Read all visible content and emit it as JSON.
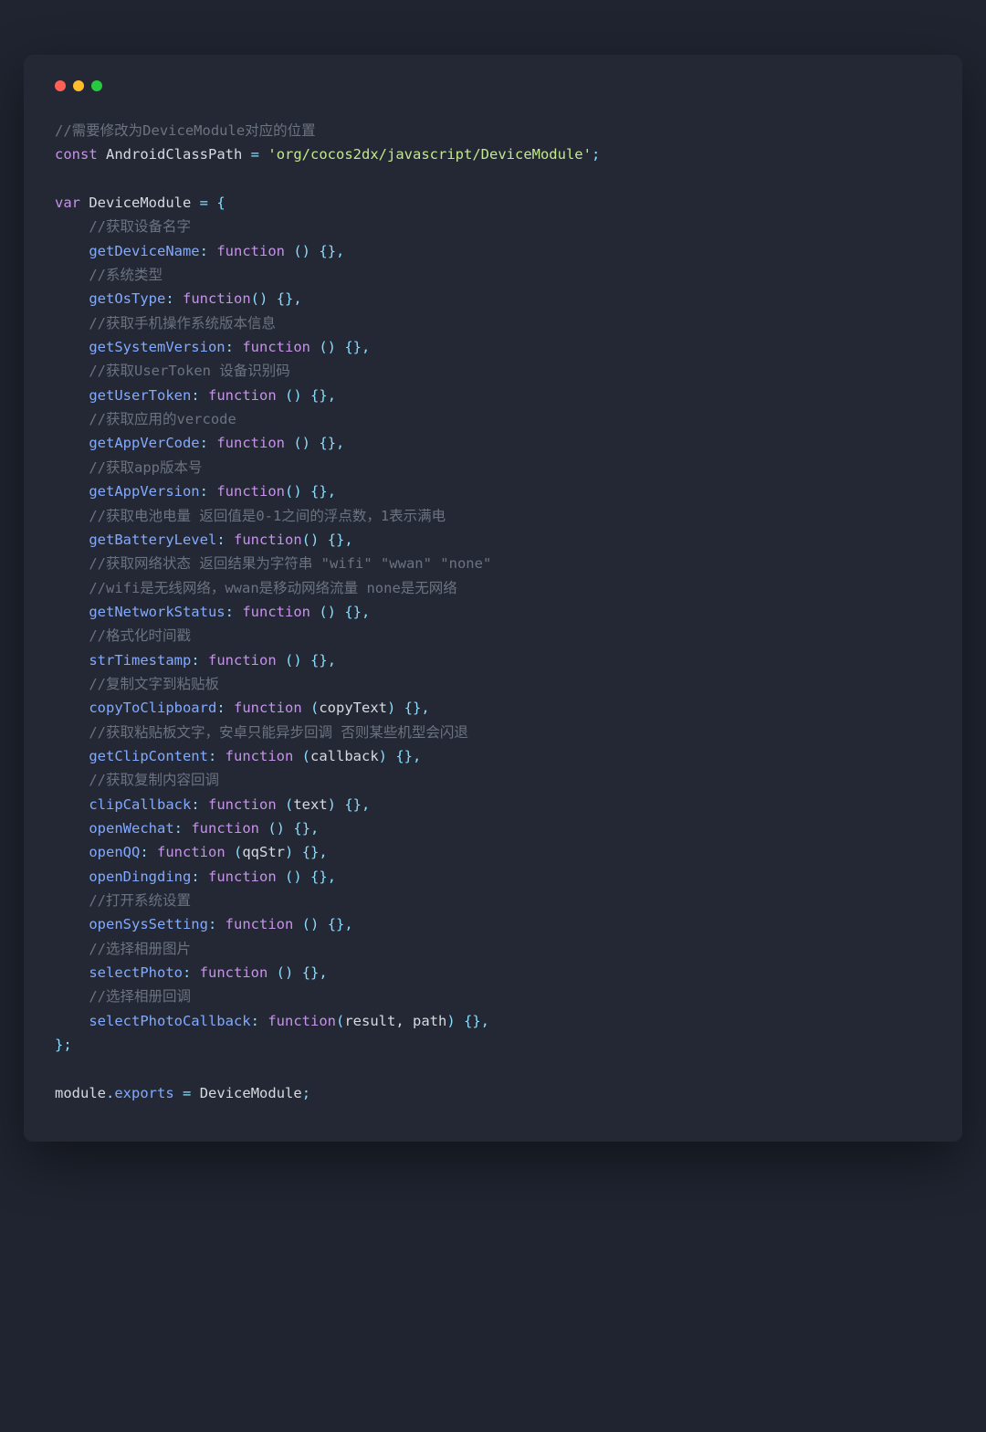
{
  "code": {
    "lines": [
      {
        "t": "cm",
        "v": "//需要修改为DeviceModule对应的位置"
      },
      {
        "t": "l1",
        "kw": "const",
        "nm": "AndroidClassPath",
        "eq": "=",
        "str": "'org/cocos2dx/javascript/DeviceModule'",
        "semi": ";"
      },
      {
        "t": "blank"
      },
      {
        "t": "l2",
        "kw": "var",
        "nm": "DeviceModule",
        "eq": "=",
        "brace": "{"
      },
      {
        "t": "cmI",
        "v": "//获取设备名字"
      },
      {
        "t": "m",
        "name": "getDeviceName",
        "args": ""
      },
      {
        "t": "cmI",
        "v": "//系统类型"
      },
      {
        "t": "m",
        "name": "getOsType",
        "args": "",
        "tight": true
      },
      {
        "t": "cmI",
        "v": "//获取手机操作系统版本信息"
      },
      {
        "t": "m",
        "name": "getSystemVersion",
        "args": ""
      },
      {
        "t": "cmI",
        "v": "//获取UserToken 设备识别码"
      },
      {
        "t": "m",
        "name": "getUserToken",
        "args": ""
      },
      {
        "t": "cmI",
        "v": "//获取应用的vercode"
      },
      {
        "t": "m",
        "name": "getAppVerCode",
        "args": ""
      },
      {
        "t": "cmI",
        "v": "//获取app版本号"
      },
      {
        "t": "m",
        "name": "getAppVersion",
        "args": "",
        "tight": true
      },
      {
        "t": "cmI",
        "v": "//获取电池电量 返回值是0-1之间的浮点数，1表示满电"
      },
      {
        "t": "m",
        "name": "getBatteryLevel",
        "args": "",
        "tight": true
      },
      {
        "t": "cmI",
        "v": "//获取网络状态 返回结果为字符串 \"wifi\" \"wwan\" \"none\""
      },
      {
        "t": "cmI",
        "v": "//wifi是无线网络，wwan是移动网络流量 none是无网络"
      },
      {
        "t": "m",
        "name": "getNetworkStatus",
        "args": ""
      },
      {
        "t": "cmI",
        "v": "//格式化时间戳"
      },
      {
        "t": "m",
        "name": "strTimestamp",
        "args": ""
      },
      {
        "t": "cmI",
        "v": "//复制文字到粘贴板"
      },
      {
        "t": "m",
        "name": "copyToClipboard",
        "args": "copyText"
      },
      {
        "t": "cmI",
        "v": "//获取粘贴板文字，安卓只能异步回调 否则某些机型会闪退"
      },
      {
        "t": "m",
        "name": "getClipContent",
        "args": "callback"
      },
      {
        "t": "cmI",
        "v": "//获取复制内容回调"
      },
      {
        "t": "m",
        "name": "clipCallback",
        "args": "text"
      },
      {
        "t": "m",
        "name": "openWechat",
        "args": ""
      },
      {
        "t": "m",
        "name": "openQQ",
        "args": "qqStr"
      },
      {
        "t": "m",
        "name": "openDingding",
        "args": ""
      },
      {
        "t": "cmI",
        "v": "//打开系统设置"
      },
      {
        "t": "m",
        "name": "openSysSetting",
        "args": ""
      },
      {
        "t": "cmI",
        "v": "//选择相册图片"
      },
      {
        "t": "m",
        "name": "selectPhoto",
        "args": ""
      },
      {
        "t": "cmI",
        "v": "//选择相册回调"
      },
      {
        "t": "m",
        "name": "selectPhotoCallback",
        "args": "result, path",
        "tight": true
      },
      {
        "t": "close"
      },
      {
        "t": "blank"
      },
      {
        "t": "exp",
        "l": "module",
        "d": ".",
        "r": "exports",
        "eq": "=",
        "nm": "DeviceModule",
        "semi": ";"
      }
    ]
  }
}
